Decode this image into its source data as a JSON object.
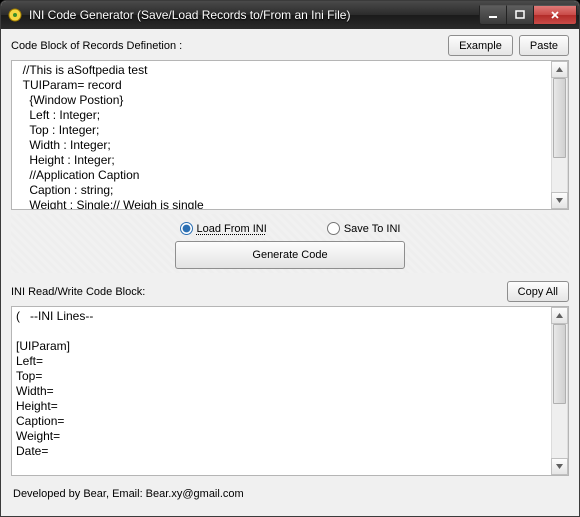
{
  "window": {
    "title": "INI Code Generator (Save/Load Records to/From an Ini File)"
  },
  "section1": {
    "label": "Code Block of Records Definetion :",
    "example_btn": "Example",
    "paste_btn": "Paste",
    "content": "  //This is aSoftpedia test\n  TUIParam= record\n    {Window Postion}\n    Left : Integer;\n    Top : Integer;\n    Width : Integer;\n    Height : Integer;\n    //Application Caption\n    Caption : string;\n    Weight : Single;// Weigh is single\n    Date : TDate;"
  },
  "middle": {
    "load_label": "Load From INI",
    "save_label": "Save To INI",
    "generate_btn": "Generate Code"
  },
  "section2": {
    "label": "INI Read/Write Code Block:",
    "copyall_btn": "Copy All",
    "content": "(   --INI Lines--\n\n[UIParam]\nLeft=\nTop=\nWidth=\nHeight=\nCaption=\nWeight=\nDate=\n\n[AppParam]\nNeedCheckSignature=\nTaskFileName="
  },
  "footer": {
    "text": "Developed by Bear, Email: Bear.xy@gmail.com"
  }
}
